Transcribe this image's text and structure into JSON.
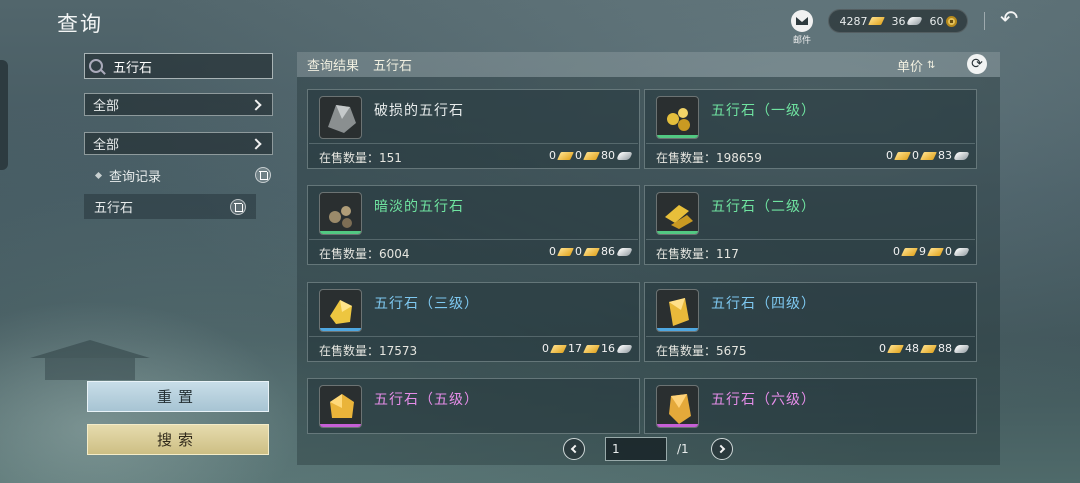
{
  "header": {
    "title": "查询",
    "mail_label": "邮件",
    "gold": "4287",
    "silver": "36",
    "copper": "60"
  },
  "sidebar": {
    "search_value": "五行石",
    "filter1": "全部",
    "filter2": "全部",
    "history_label": "查询记录",
    "history_items": [
      "五行石"
    ],
    "reset_label": "重置",
    "search_label": "搜索"
  },
  "results": {
    "label": "查询结果",
    "query": "五行石",
    "sort_label": "单价",
    "stock_label": "在售数量：",
    "items": [
      {
        "name": "破损的五行石",
        "stock": "151",
        "gold": "0",
        "silver": "0",
        "copper": "80",
        "color": "#e8ecec",
        "bar": "none",
        "icon": "broken-stone-icon"
      },
      {
        "name": "五行石（一级）",
        "stock": "198659",
        "gold": "0",
        "silver": "0",
        "copper": "83",
        "color": "#6fe3a0",
        "bar": "#52c882",
        "icon": "stone-lv1-icon"
      },
      {
        "name": "暗淡的五行石",
        "stock": "6004",
        "gold": "0",
        "silver": "0",
        "copper": "86",
        "color": "#6fe3a0",
        "bar": "#52c882",
        "icon": "dim-stone-icon"
      },
      {
        "name": "五行石（二级）",
        "stock": "117",
        "gold": "0",
        "silver": "9",
        "copper": "0",
        "color": "#6fe3a0",
        "bar": "#52c882",
        "icon": "stone-lv2-icon"
      },
      {
        "name": "五行石（三级）",
        "stock": "17573",
        "gold": "0",
        "silver": "17",
        "copper": "16",
        "color": "#7ec8f0",
        "bar": "#4fa7e0",
        "icon": "stone-lv3-icon"
      },
      {
        "name": "五行石（四级）",
        "stock": "5675",
        "gold": "0",
        "silver": "48",
        "copper": "88",
        "color": "#7ec8f0",
        "bar": "#4fa7e0",
        "icon": "stone-lv4-icon"
      },
      {
        "name": "五行石（五级）",
        "stock": "",
        "gold": "",
        "silver": "",
        "copper": "",
        "color": "#e58de8",
        "bar": "#c65fd6",
        "icon": "stone-lv5-icon"
      },
      {
        "name": "五行石（六级）",
        "stock": "",
        "gold": "",
        "silver": "",
        "copper": "",
        "color": "#e58de8",
        "bar": "#c65fd6",
        "icon": "stone-lv6-icon"
      }
    ]
  },
  "pager": {
    "current": "1",
    "total": "/1"
  }
}
